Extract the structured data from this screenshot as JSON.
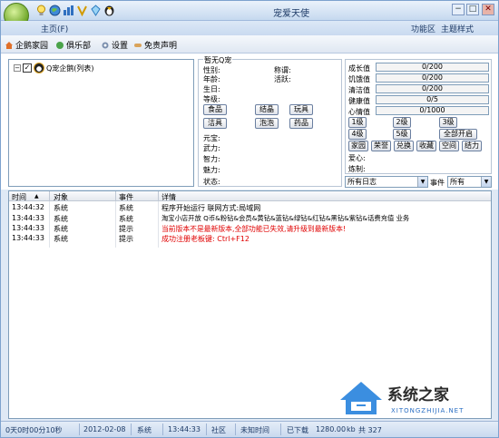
{
  "window": {
    "title": "宠爱天使",
    "minimize": "−",
    "maximize": "□",
    "close": "✕"
  },
  "menubar": {
    "home": "主页(F)",
    "community": "功能区",
    "theme": "主题样式"
  },
  "toolbar": {
    "penguin_home": "企鹅家园",
    "club": "俱乐部",
    "settings": "设置",
    "disclaimer": "免责声明"
  },
  "tree": {
    "collapse": "−",
    "checked": "✓",
    "root_label": "Q宠企鹅(列表)"
  },
  "info": {
    "group_title": "暂无Q宠",
    "gender": "性别:",
    "title_label": "称谓:",
    "age": "年龄:",
    "activity": "活跃:",
    "birthday": "生日:",
    "level": "等级:",
    "food": "食品",
    "crystal": "结晶",
    "toy": "玩具",
    "cleaning": "洁具",
    "bubble": "泡泡",
    "medicine": "药品",
    "yuanbao": "元宝:",
    "strength": "武力:",
    "intelligence": "智力:",
    "charm": "魅力:",
    "status": "状态:"
  },
  "stats": [
    {
      "label": "成长值",
      "value": "0/200"
    },
    {
      "label": "饥饿值",
      "value": "0/200"
    },
    {
      "label": "清洁值",
      "value": "0/200"
    },
    {
      "label": "健康值",
      "value": "0/5"
    },
    {
      "label": "心情值",
      "value": "0/1000"
    }
  ],
  "level_buttons": [
    "1级",
    "2级",
    "3级",
    "4级",
    "5级",
    "全部开启"
  ],
  "action_buttons": [
    "家园",
    "荣誉",
    "兑换",
    "收藏",
    "空间",
    "结力"
  ],
  "extra": {
    "love": "爱心:",
    "refine": "炼制:"
  },
  "filters": {
    "log": "所有日志",
    "event_label": "事件",
    "event": "所有"
  },
  "table": {
    "headers": [
      "时间",
      "对象",
      "事件",
      "详情"
    ],
    "rows": [
      {
        "time": "13:44:32",
        "object": "系统",
        "event": "系统",
        "detail": "程序开始运行 联网方式:局域网",
        "color": "#000000"
      },
      {
        "time": "13:44:33",
        "object": "系统",
        "event": "系统",
        "detail": "淘宝小店开放 Q币&粉钻&会员&黄钻&蓝钻&绿钻&红钻&黑钻&紫钻&话费充值 业务",
        "color": "#000000"
      },
      {
        "time": "13:44:33",
        "object": "系统",
        "event": "提示",
        "detail": "当前版本不是最新版本,全部功能已失效,请升级到最新版本!",
        "color": "#e00000"
      },
      {
        "time": "13:44:33",
        "object": "系统",
        "event": "提示",
        "detail": "成功注册老板键: Ctrl+F12",
        "color": "#e00000"
      }
    ]
  },
  "status": {
    "runtime": "0天0时00分10秒",
    "date": "2012-02-08",
    "source": "系统",
    "time": "13:44:33",
    "area": "社区",
    "unknown_time": "未知时间",
    "downloaded": "已下载",
    "size": "1280.00",
    "unit": "kb",
    "total": "共 327"
  },
  "watermark": {
    "text": "系统之家",
    "url": "XITONGZHIJIA.NET"
  },
  "colors": {
    "accent": "#1d3a66",
    "error": "#e00000",
    "border": "#7f9db9"
  }
}
